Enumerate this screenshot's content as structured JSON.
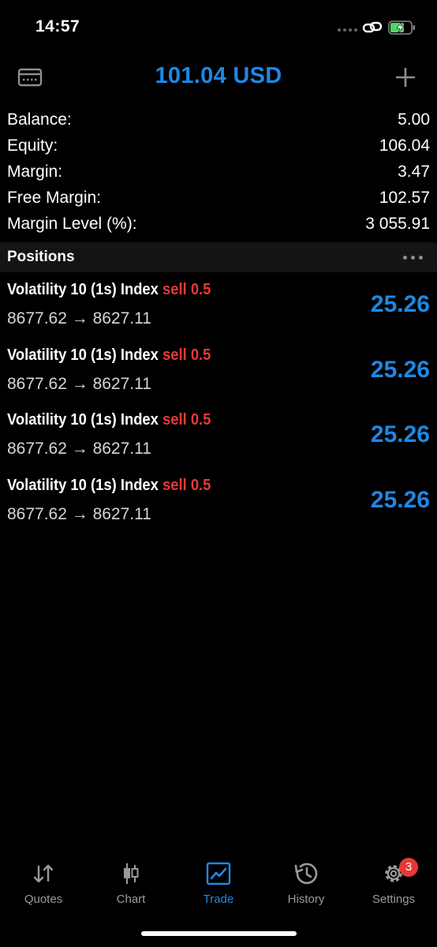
{
  "status_bar": {
    "time": "14:57"
  },
  "header": {
    "title": "101.04 USD"
  },
  "summary": [
    {
      "label": "Balance:",
      "value": "5.00"
    },
    {
      "label": "Equity:",
      "value": "106.04"
    },
    {
      "label": "Margin:",
      "value": "3.47"
    },
    {
      "label": "Free Margin:",
      "value": "102.57"
    },
    {
      "label": "Margin Level (%):",
      "value": "3 055.91"
    }
  ],
  "positions": {
    "title": "Positions",
    "items": [
      {
        "symbol": "Volatility 10 (1s) Index",
        "side": "sell 0.5",
        "prices": "8677.62 → 8627.11",
        "profit": "25.26"
      },
      {
        "symbol": "Volatility 10 (1s) Index",
        "side": "sell 0.5",
        "prices": "8677.62 → 8627.11",
        "profit": "25.26"
      },
      {
        "symbol": "Volatility 10 (1s) Index",
        "side": "sell 0.5",
        "prices": "8677.62 → 8627.11",
        "profit": "25.26"
      },
      {
        "symbol": "Volatility 10 (1s) Index",
        "side": "sell 0.5",
        "prices": "8677.62 → 8627.11",
        "profit": "25.26"
      }
    ]
  },
  "tabs": [
    {
      "label": "Quotes",
      "icon": "quotes-icon"
    },
    {
      "label": "Chart",
      "icon": "chart-icon"
    },
    {
      "label": "Trade",
      "icon": "trade-icon",
      "active": true
    },
    {
      "label": "History",
      "icon": "history-icon"
    },
    {
      "label": "Settings",
      "icon": "settings-icon",
      "badge": "3"
    }
  ],
  "colors": {
    "accent": "#1e88e5",
    "sell": "#e53935",
    "background": "#000000"
  }
}
